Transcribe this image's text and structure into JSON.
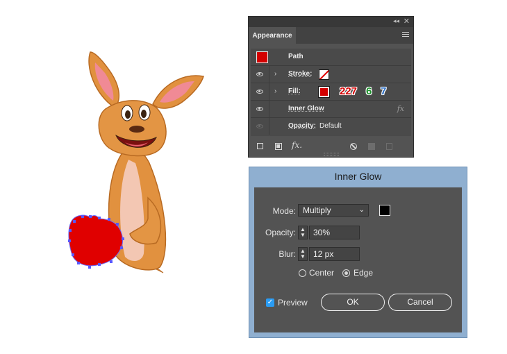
{
  "appearance_panel": {
    "collapse_glyph": "◂◂",
    "close_glyph": "✕",
    "tab_label": "Appearance",
    "rows": {
      "path_label": "Path",
      "stroke_label": "Stroke:",
      "fill_label": "Fill:",
      "fill_rgb": [
        "227",
        "6",
        "7"
      ],
      "inner_glow_label": "Inner Glow",
      "opacity_label": "Opacity:",
      "opacity_value": "Default"
    },
    "fx_glyph": "fx",
    "fx_button_glyph": "fx."
  },
  "inner_glow_dialog": {
    "title": "Inner Glow",
    "mode_label": "Mode:",
    "mode_value": "Multiply",
    "opacity_label": "Opacity:",
    "opacity_value": "30%",
    "blur_label": "Blur:",
    "blur_value": "12 px",
    "center_label": "Center",
    "edge_label": "Edge",
    "selected_option": "Edge",
    "preview_label": "Preview",
    "preview_checked": true,
    "ok_label": "OK",
    "cancel_label": "Cancel"
  },
  "colors": {
    "path_fill": "#d30000",
    "glow_color": "#000000",
    "rgb_r": "#d40000",
    "rgb_g": "#1a8f2a",
    "rgb_b": "#1f66c2"
  }
}
